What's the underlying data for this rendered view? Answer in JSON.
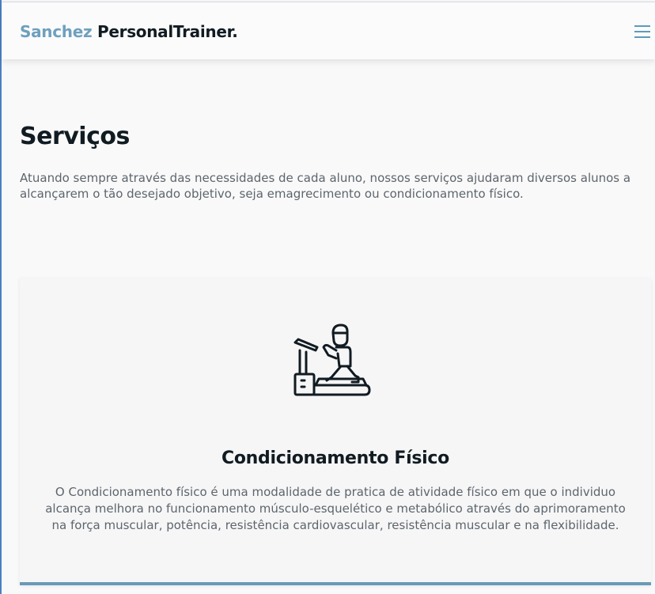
{
  "header": {
    "brand": "Sanchez",
    "brand_rest": "PersonalTrainer.",
    "menu_icon": "hamburger-menu-icon"
  },
  "section": {
    "title": "Serviços",
    "intro": "Atuando sempre através das necessidades de cada aluno, nossos serviços ajudaram diversos alunos a alcançarem o tão desejado objetivo, seja emagrecimento ou condicionamento físico."
  },
  "card": {
    "icon": "treadmill-runner-icon",
    "title": "Condicionamento Físico",
    "text": "O Condicionamento físico é uma modalidade de pratica de atividade físico em que o individuo alcança melhora no funcionamento músculo-esquelético e metabólico através do aprimoramento na força muscular, potência, resistência cardiovascular, resistência muscular e na flexibilidade.",
    "accent_color": "#6a9ab7"
  },
  "colors": {
    "brand": "#6fa0bd",
    "text_dark": "#111b22",
    "text_muted": "#5d656b"
  }
}
